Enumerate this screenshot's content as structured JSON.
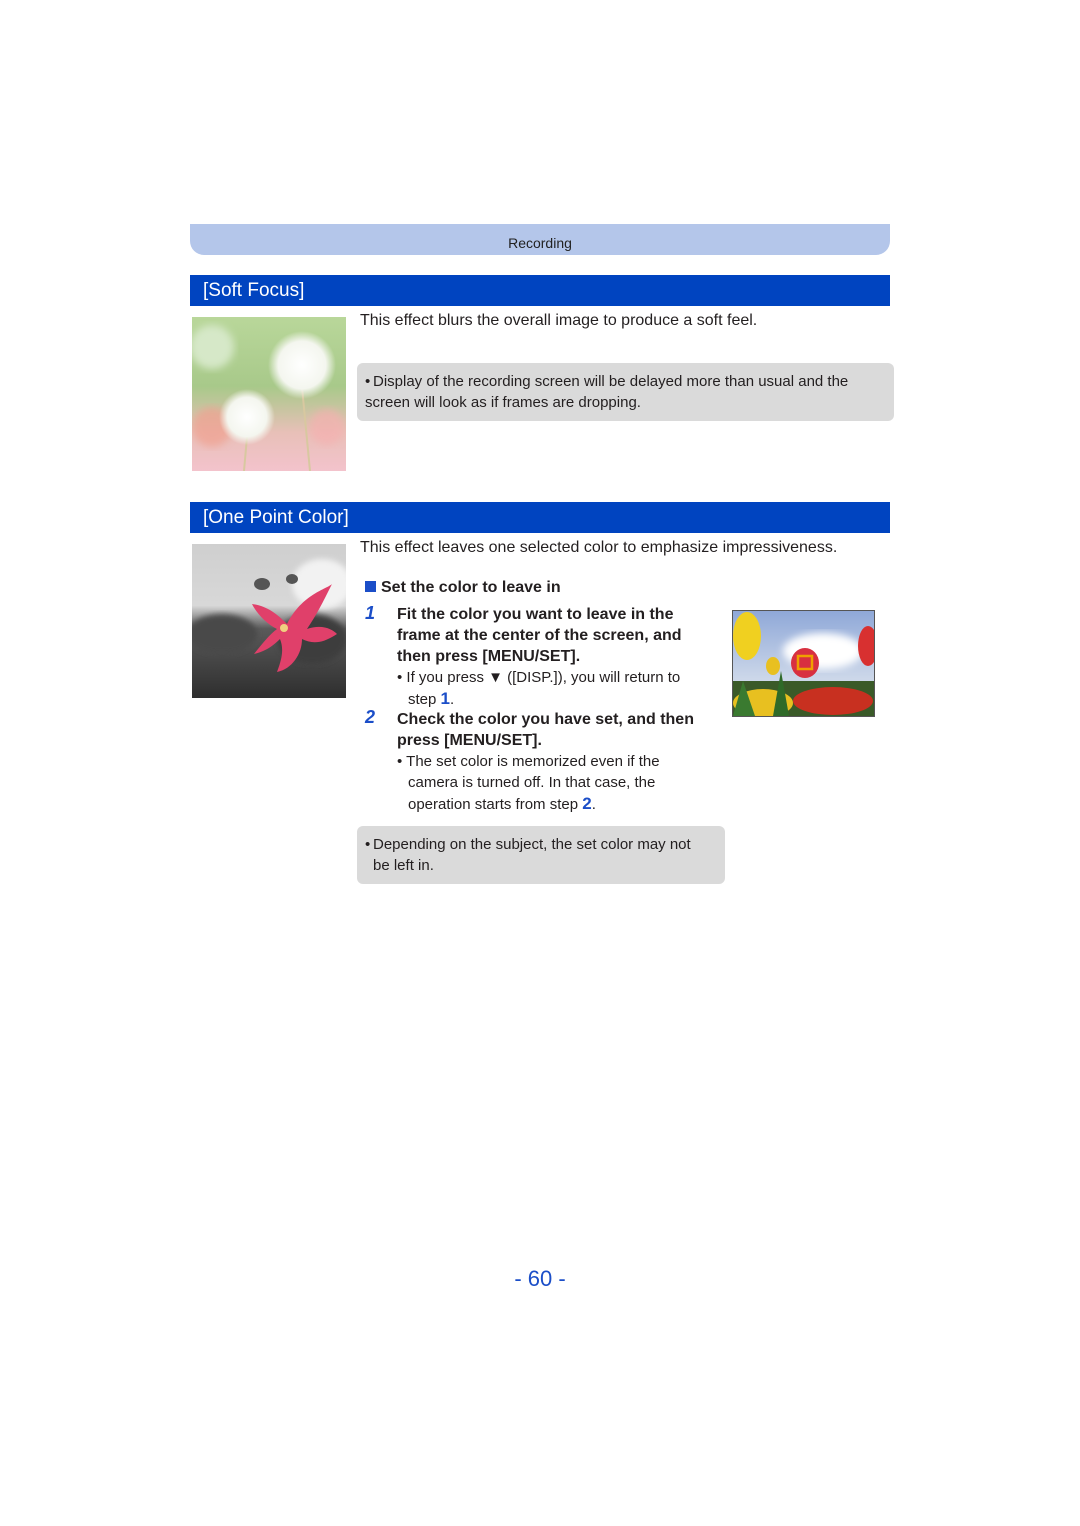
{
  "chapter": "Recording",
  "soft_focus": {
    "title": "[Soft Focus]",
    "description": "This effect blurs the overall image to produce a soft feel.",
    "note": "Display of the recording screen will be delayed more than usual and the screen will look as if frames are dropping.",
    "image_alt": "dandelion-soft-focus-photo"
  },
  "one_point_color": {
    "title": "[One Point Color]",
    "description": "This effect leaves one selected color to emphasize impressiveness.",
    "subheading": "Set the color to leave in",
    "steps": [
      {
        "num": "1",
        "line1": "Fit the color you want to leave in the",
        "line2": "frame at the center of the screen, and",
        "line3": "then press [MENU/SET].",
        "bullet_a": "If you press ▼ ([DISP.]), you will return to",
        "bullet_b": "step ",
        "ref": "1",
        "bullet_c": "."
      },
      {
        "num": "2",
        "line1": "Check the color you have set, and then",
        "line2": "press [MENU/SET].",
        "bullet_a": "The set color is memorized even if the",
        "bullet_b": "camera is turned off. In that case, the",
        "bullet_c": "operation starts from step ",
        "ref": "2",
        "bullet_d": "."
      }
    ],
    "note": "Depending on the subject, the set color may not be left in.",
    "note_line1": "Depending on the subject, the set color may not",
    "note_line2": "be left in."
  },
  "page_number": "- 60 -",
  "colors": {
    "accent_blue": "#0044c0",
    "chapter_bar": "#b4c6ea",
    "note_bg": "#dadada",
    "step_blue": "#1b4ec8"
  }
}
